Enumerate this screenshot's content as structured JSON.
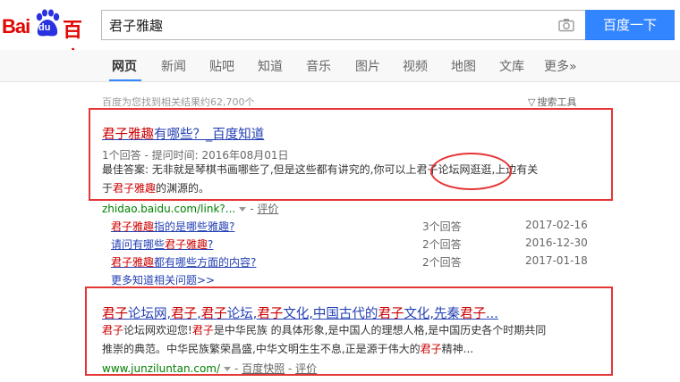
{
  "logo": {
    "bai": "Bai",
    "du": "du",
    "baidu_cn": "百度"
  },
  "search": {
    "value": "君子雅趣",
    "button_label": "百度一下"
  },
  "tabs": [
    {
      "label": "网页",
      "active": true
    },
    {
      "label": "新闻"
    },
    {
      "label": "贴吧"
    },
    {
      "label": "知道"
    },
    {
      "label": "音乐"
    },
    {
      "label": "图片"
    },
    {
      "label": "视频"
    },
    {
      "label": "地图"
    },
    {
      "label": "文库"
    },
    {
      "label": "更多»"
    }
  ],
  "result_count": "百度为您找到相关结果约62,700个",
  "tools_label": "搜索工具",
  "results": [
    {
      "title_em": "君子雅趣",
      "title_rest": "有哪些？_百度知道",
      "meta": "1个回答 - 提问时间: 2016年08月01日",
      "abstract_line1": "最佳答案: 无非就是琴棋书画哪些了,但是这些都有讲究的,你可以上君子论坛网逛逛,上边有关",
      "abstract_line2_pre": "于",
      "abstract_line2_em": "君子雅趣",
      "abstract_line2_post": "的渊源的。",
      "url": "zhidao.baidu.com/link?...",
      "review": "评价",
      "sub_questions": [
        {
          "em": "君子雅趣",
          "rest": "指的是哪些雅趣?",
          "pre": "",
          "count": "3个回答",
          "date": "2017-02-16"
        },
        {
          "pre": "请问有哪些",
          "em": "君子雅趣",
          "rest": "?",
          "count": "2个回答",
          "date": "2016-12-30"
        },
        {
          "em": "君子雅趣",
          "rest": "都有哪些方面的内容?",
          "pre": "",
          "count": "2个回答",
          "date": "2017-01-18"
        }
      ],
      "more": "更多知道相关问题>>"
    },
    {
      "title": "君子论坛网,君子,君子论坛,君子文化,中国古代的君子文化,先秦君子...",
      "abstract_line1": "君子论坛网欢迎您!君子是中华民族 的具体形象,是中国人的理想人格,是中国历史各个时期共同",
      "abstract_line2": "推崇的典范。中华民族繁荣昌盛,中华文明生生不息,正是源于伟大的君子精神...",
      "url": "www.junziluntan.com/",
      "snapshot": "百度快照",
      "review": "评价"
    }
  ],
  "colors": {
    "accent": "#3385ff",
    "logo_red": "#e10601",
    "link": "#2440b3",
    "highlight": "#c00000",
    "url_green": "#008000",
    "annotation": "#e53535"
  }
}
